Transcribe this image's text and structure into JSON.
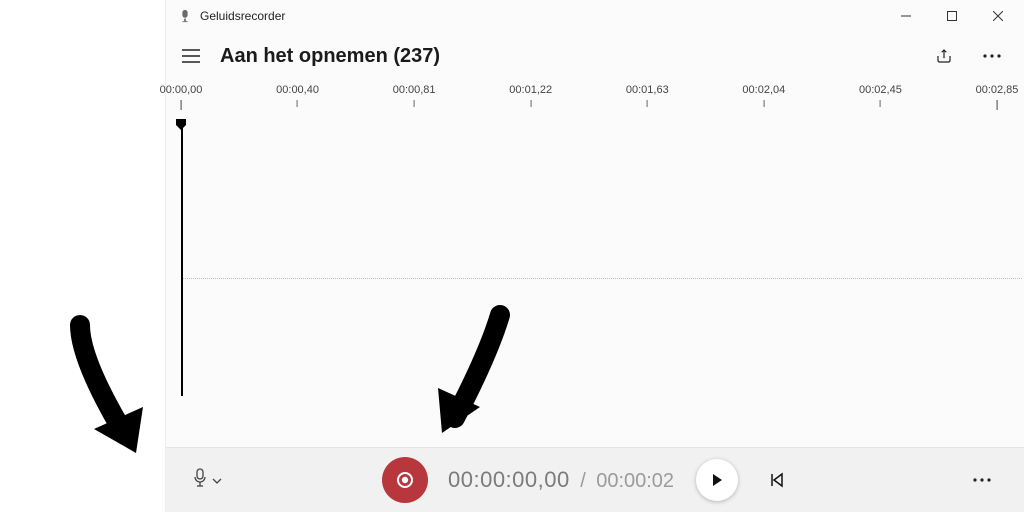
{
  "app": {
    "name": "Geluidsrecorder"
  },
  "header": {
    "title": "Aan het opnemen (237)"
  },
  "ruler": {
    "ticks": [
      "00:00,00",
      "00:00,40",
      "00:00,81",
      "00:01,22",
      "00:01,63",
      "00:02,04",
      "00:02,45",
      "00:02,85"
    ]
  },
  "transport": {
    "current": "00:00:00,00",
    "separator": "/",
    "total": "00:00:02"
  },
  "colors": {
    "record": "#b8373d"
  }
}
